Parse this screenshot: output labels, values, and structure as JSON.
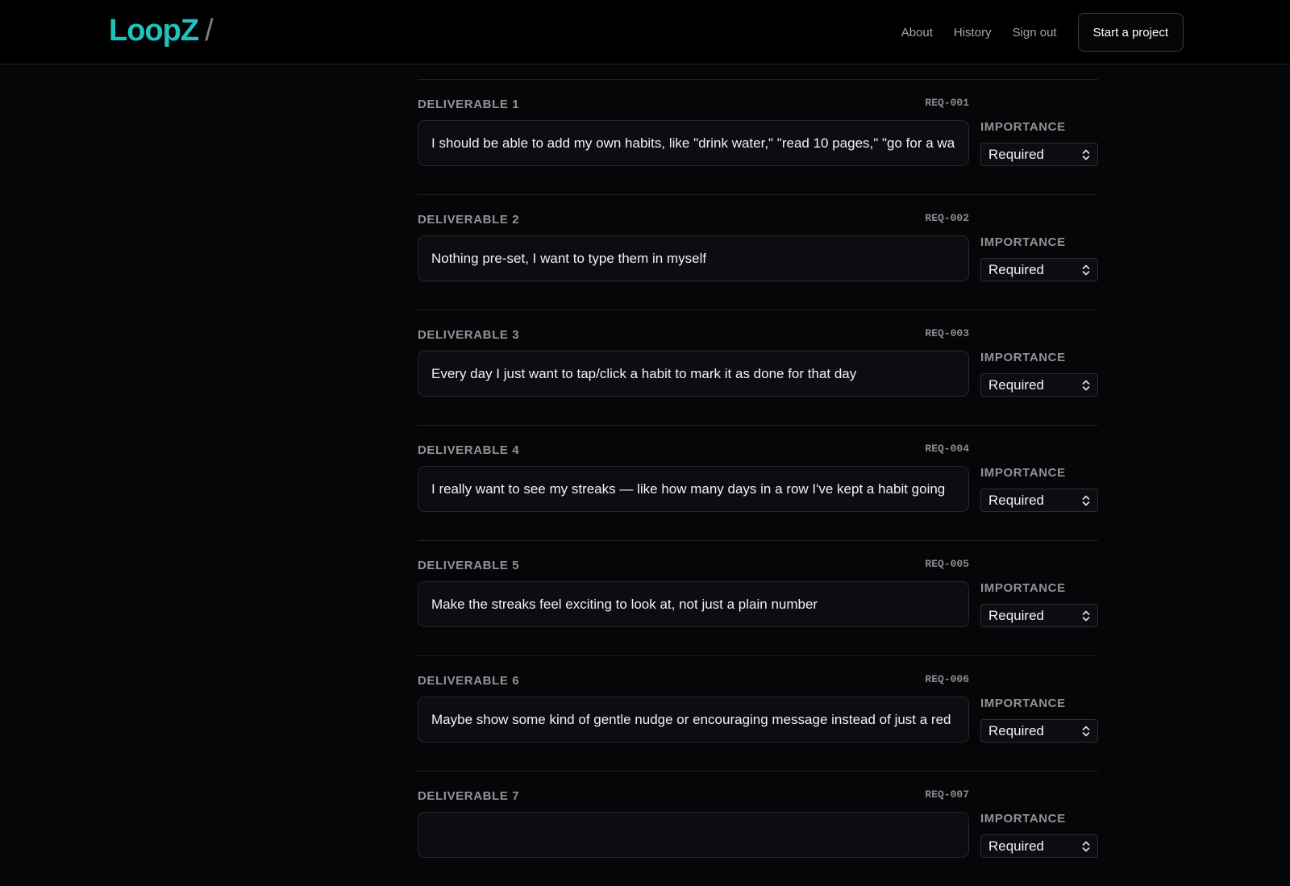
{
  "brand": {
    "name": "LoopZ",
    "separator": "/"
  },
  "nav": {
    "about": "About",
    "history": "History",
    "sign_out": "Sign out",
    "start_project": "Start a project"
  },
  "colors": {
    "brand": "#1fc3bd",
    "background": "#060608"
  },
  "deliverables": [
    {
      "title": "DELIVERABLE 1",
      "req": "REQ-001",
      "text": "I should be able to add my own habits, like \"drink water,\" \"read 10 pages,\" \"go for a walk\"",
      "importance_label": "IMPORTANCE",
      "importance": "Required"
    },
    {
      "title": "DELIVERABLE 2",
      "req": "REQ-002",
      "text": "Nothing pre-set, I want to type them in myself",
      "importance_label": "IMPORTANCE",
      "importance": "Required"
    },
    {
      "title": "DELIVERABLE 3",
      "req": "REQ-003",
      "text": "Every day I just want to tap/click a habit to mark it as done for that day",
      "importance_label": "IMPORTANCE",
      "importance": "Required"
    },
    {
      "title": "DELIVERABLE 4",
      "req": "REQ-004",
      "text": "I really want to see my streaks — like how many days in a row I've kept a habit going",
      "importance_label": "IMPORTANCE",
      "importance": "Required"
    },
    {
      "title": "DELIVERABLE 5",
      "req": "REQ-005",
      "text": "Make the streaks feel exciting to look at, not just a plain number",
      "importance_label": "IMPORTANCE",
      "importance": "Required"
    },
    {
      "title": "DELIVERABLE 6",
      "req": "REQ-006",
      "text": "Maybe show some kind of gentle nudge or encouraging message instead of just a red X",
      "importance_label": "IMPORTANCE",
      "importance": "Required"
    },
    {
      "title": "DELIVERABLE 7",
      "req": "REQ-007",
      "text": "",
      "importance_label": "IMPORTANCE",
      "importance": "Required"
    }
  ]
}
